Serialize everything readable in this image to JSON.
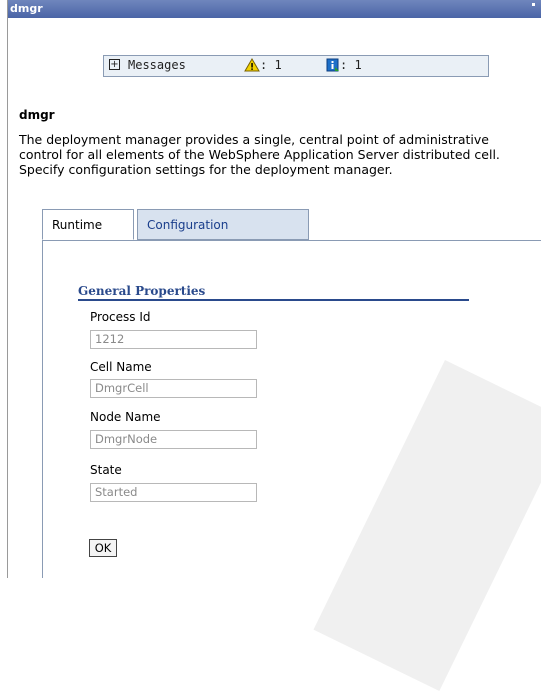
{
  "window": {
    "title": "dmgr"
  },
  "messages": {
    "label": "Messages",
    "warning_count": ": 1",
    "info_count": ": 1"
  },
  "page": {
    "title": "dmgr",
    "description": "The deployment manager provides a single, central point of administrative control for all elements of the WebSphere Application Server distributed cell. Specify configuration settings for the deployment manager."
  },
  "tabs": [
    {
      "label": "Runtime",
      "active": true
    },
    {
      "label": "Configuration",
      "active": false
    }
  ],
  "general_properties": {
    "heading": "General Properties",
    "fields": [
      {
        "label": "Process Id",
        "value": "1212"
      },
      {
        "label": "Cell Name",
        "value": "DmgrCell"
      },
      {
        "label": "Node Name",
        "value": "DmgrNode"
      },
      {
        "label": "State",
        "value": "Started"
      }
    ]
  },
  "buttons": {
    "ok_label": "OK"
  },
  "colors": {
    "title_bar": "#4a64a6",
    "link": "#1a3e8c",
    "section_heading": "#2a4a8c",
    "tab_inactive_bg": "#d8e2ef"
  }
}
